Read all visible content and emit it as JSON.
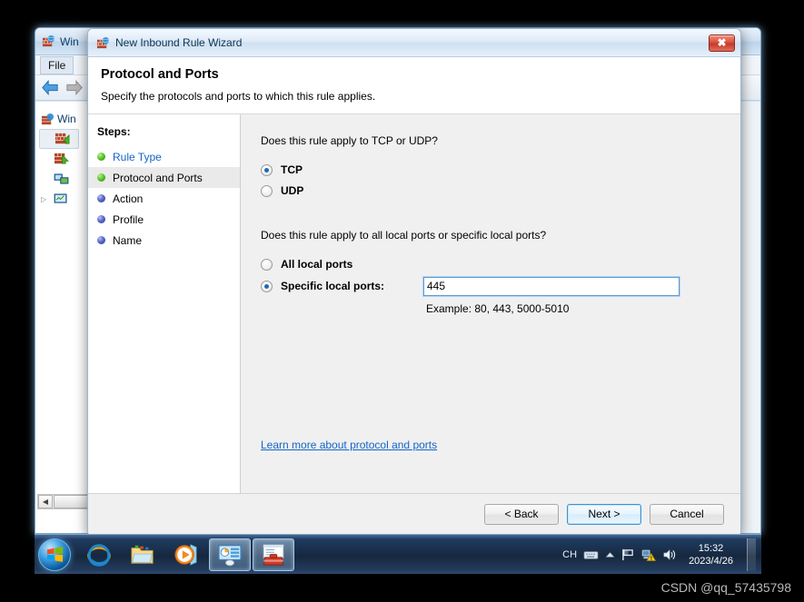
{
  "background_window": {
    "title": "Win",
    "menu": [
      {
        "label": "File"
      }
    ],
    "toolbar": [
      {
        "name": "back-arrow-icon"
      },
      {
        "name": "forward-arrow-icon"
      }
    ],
    "tree": {
      "root_label": "Win",
      "items": [
        {
          "name": "inbound-rules",
          "selected": true
        },
        {
          "name": "outbound-rules",
          "selected": false
        },
        {
          "name": "connection-security-rules",
          "selected": false
        },
        {
          "name": "monitoring",
          "selected": false,
          "expandable": true
        }
      ]
    }
  },
  "wizard": {
    "title": "New Inbound Rule Wizard",
    "close_label": "✖",
    "header": {
      "heading": "Protocol and Ports",
      "subheading": "Specify the protocols and ports to which this rule applies."
    },
    "steps": {
      "heading": "Steps:",
      "items": [
        {
          "label": "Rule Type",
          "state": "done",
          "is_link": true
        },
        {
          "label": "Protocol and Ports",
          "state": "done",
          "is_link": false
        },
        {
          "label": "Action",
          "state": "todo",
          "is_link": false
        },
        {
          "label": "Profile",
          "state": "todo",
          "is_link": false
        },
        {
          "label": "Name",
          "state": "todo",
          "is_link": false
        }
      ]
    },
    "content": {
      "protocol_question": "Does this rule apply to TCP or UDP?",
      "protocol_options": [
        {
          "label": "TCP",
          "selected": true
        },
        {
          "label": "UDP",
          "selected": false
        }
      ],
      "ports_question": "Does this rule apply to all local ports or specific local ports?",
      "all_ports_label": "All local ports",
      "all_ports_selected": false,
      "specific_ports_label": "Specific local ports:",
      "specific_ports_selected": true,
      "ports_value": "445",
      "ports_example": "Example: 80, 443, 5000-5010",
      "learn_more_link": "Learn more about protocol and ports"
    },
    "footer": {
      "back_label": "< Back",
      "next_label": "Next >",
      "cancel_label": "Cancel",
      "default_button": "next"
    }
  },
  "taskbar": {
    "start_label": "start-orb",
    "buttons": [
      {
        "name": "internet-explorer",
        "active": false
      },
      {
        "name": "windows-explorer",
        "active": false
      },
      {
        "name": "windows-media-player",
        "active": false
      },
      {
        "name": "control-panel",
        "active": true
      },
      {
        "name": "mmc-console",
        "active": true
      }
    ],
    "tray": {
      "ime_label": "CH",
      "icons": [
        "keyboard-icon",
        "chevron-up-icon",
        "flag-icon",
        "network-warning-icon",
        "volume-icon"
      ],
      "time": "15:32",
      "date": "2023/4/26"
    }
  },
  "watermark": "CSDN @qq_57435798",
  "colors": {
    "accent": "#1464c8",
    "close_red": "#c43a28",
    "step_done": "#5dc72c",
    "step_todo": "#5b68c9"
  }
}
